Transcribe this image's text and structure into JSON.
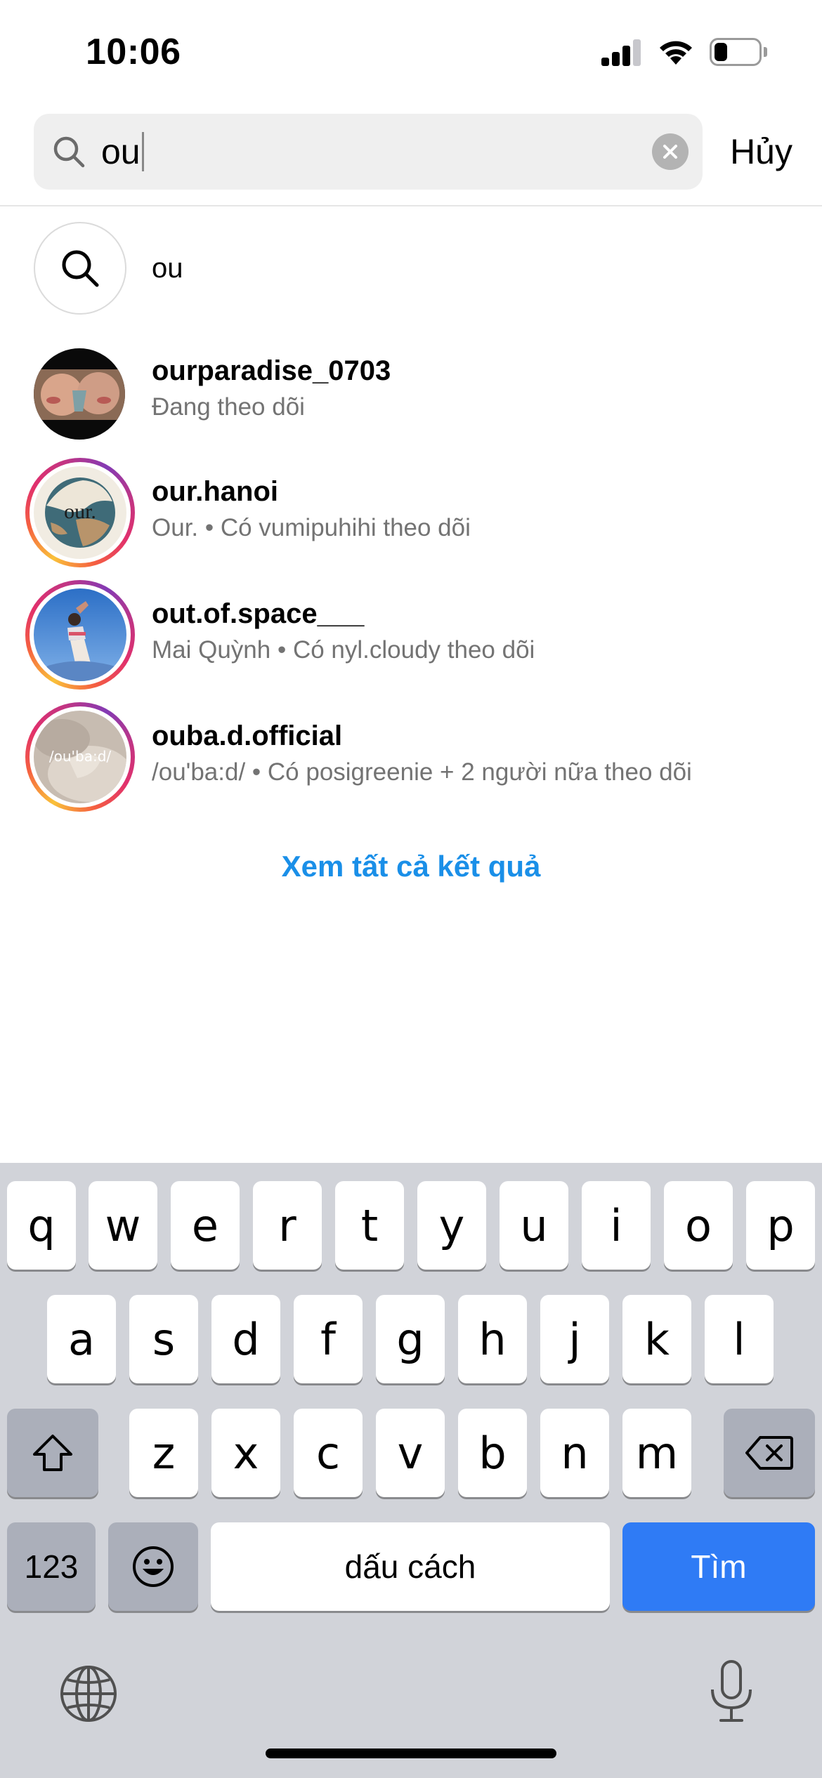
{
  "status_bar": {
    "time": "10:06"
  },
  "search": {
    "query": "ou",
    "cancel_label": "Hủy"
  },
  "suggestion": {
    "text": "ou"
  },
  "results": [
    {
      "username": "ourparadise_0703",
      "subtitle": "Đang theo dõi",
      "has_story_ring": false
    },
    {
      "username": "our.hanoi",
      "subtitle": "Our. • Có vumipuhihi theo dõi",
      "avatar_text": "our.",
      "has_story_ring": true
    },
    {
      "username": "out.of.space___",
      "subtitle": "Mai Quỳnh • Có nyl.cloudy theo dõi",
      "has_story_ring": true
    },
    {
      "username": "ouba.d.official",
      "subtitle": "/ou'ba:d/ • Có posigreenie + 2 người nữa theo dõi",
      "avatar_text": "/ou'ba:d/",
      "has_story_ring": true
    }
  ],
  "see_all_label": "Xem tất cả kết quả",
  "colors": {
    "link_blue": "#1a8fe8",
    "key_blue": "#2f7bf5",
    "keyboard_bg": "#d1d3d9"
  },
  "keyboard": {
    "row1": [
      "q",
      "w",
      "e",
      "r",
      "t",
      "y",
      "u",
      "i",
      "o",
      "p"
    ],
    "row2": [
      "a",
      "s",
      "d",
      "f",
      "g",
      "h",
      "j",
      "k",
      "l"
    ],
    "row3": [
      "z",
      "x",
      "c",
      "v",
      "b",
      "n",
      "m"
    ],
    "numbers_label": "123",
    "space_label": "dấu cách",
    "return_label": "Tìm",
    "icons": [
      "shift-icon",
      "backspace-icon",
      "emoji-icon",
      "globe-icon",
      "microphone-icon"
    ]
  }
}
